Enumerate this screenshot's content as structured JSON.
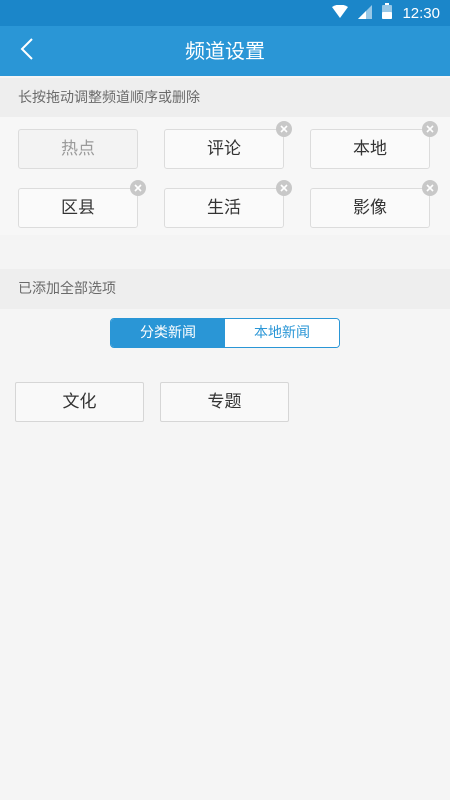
{
  "status_bar": {
    "time": "12:30",
    "icons": [
      "wifi-icon",
      "signal-icon",
      "battery-icon"
    ]
  },
  "titlebar": {
    "title": "频道设置",
    "back_icon": "back-arrow-icon"
  },
  "my_channels": {
    "hint": "长按拖动调整频道顺序或删除",
    "items": [
      {
        "label": "热点",
        "removable": false
      },
      {
        "label": "评论",
        "removable": true
      },
      {
        "label": "本地",
        "removable": true
      },
      {
        "label": "区县",
        "removable": true
      },
      {
        "label": "生活",
        "removable": true
      },
      {
        "label": "影像",
        "removable": true
      }
    ]
  },
  "added_section": {
    "title": "已添加全部选项"
  },
  "tabs": [
    {
      "label": "分类新闻",
      "active": true
    },
    {
      "label": "本地新闻",
      "active": false
    }
  ],
  "available_channels": [
    {
      "label": "文化"
    },
    {
      "label": "专题"
    }
  ],
  "colors": {
    "primary": "#2a96d6",
    "status_bar": "#1b86c9",
    "background": "#f5f5f5"
  }
}
